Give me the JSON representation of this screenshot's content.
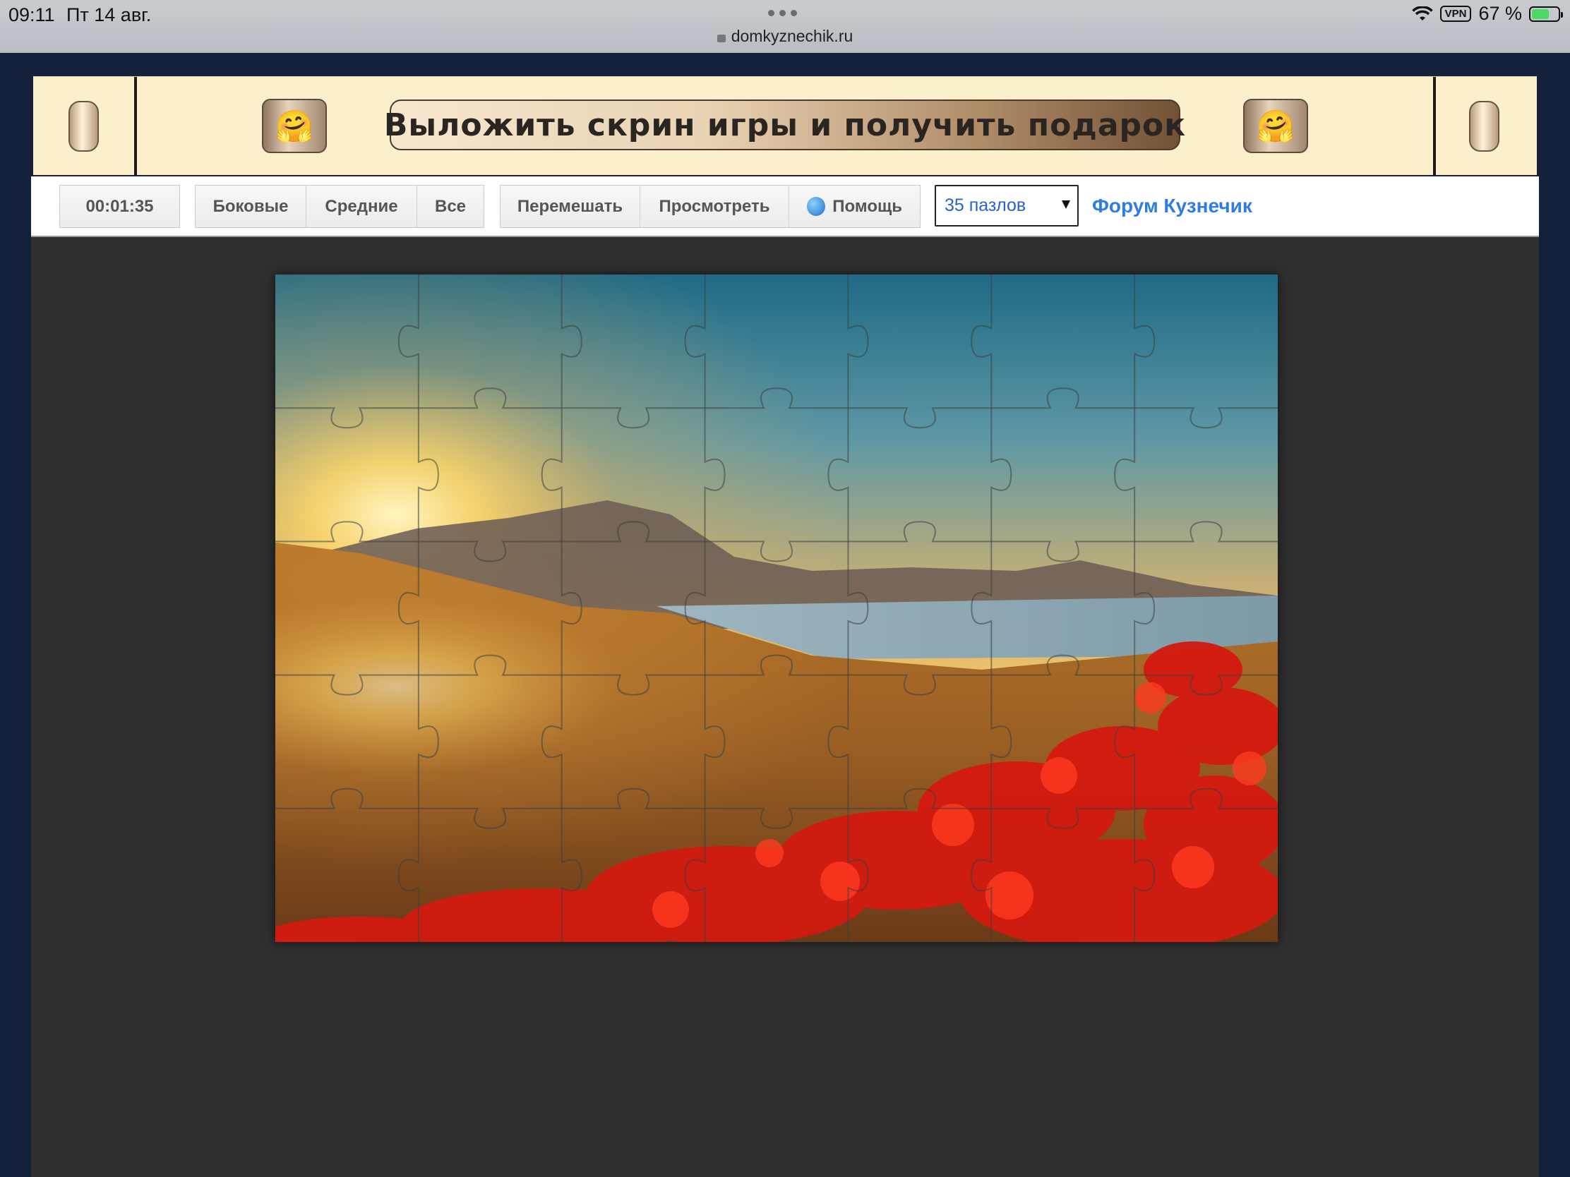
{
  "status_bar": {
    "time": "09:11",
    "date": "Пт 14 авг.",
    "url": "domkyznechik.ru",
    "vpn": "VPN",
    "battery": "67 %",
    "battery_level": 0.67
  },
  "banner": {
    "text": "Выложить скрин игры и получить подарок",
    "emoji": "🤗"
  },
  "toolbar": {
    "timer": "00:01:35",
    "filter_buttons": [
      "Боковые",
      "Средние",
      "Все"
    ],
    "action_buttons": [
      "Перемешать",
      "Просмотреть",
      "Помощь"
    ],
    "pieces_select": "35 пазлов",
    "forum_link": "Форум Кузнечик"
  },
  "puzzle": {
    "columns": 7,
    "rows": 5
  },
  "colors": {
    "page_background": "#15203a",
    "banner_background": "#fcefcc",
    "play_area": "#2f2f2f",
    "link": "#2f7de0"
  }
}
